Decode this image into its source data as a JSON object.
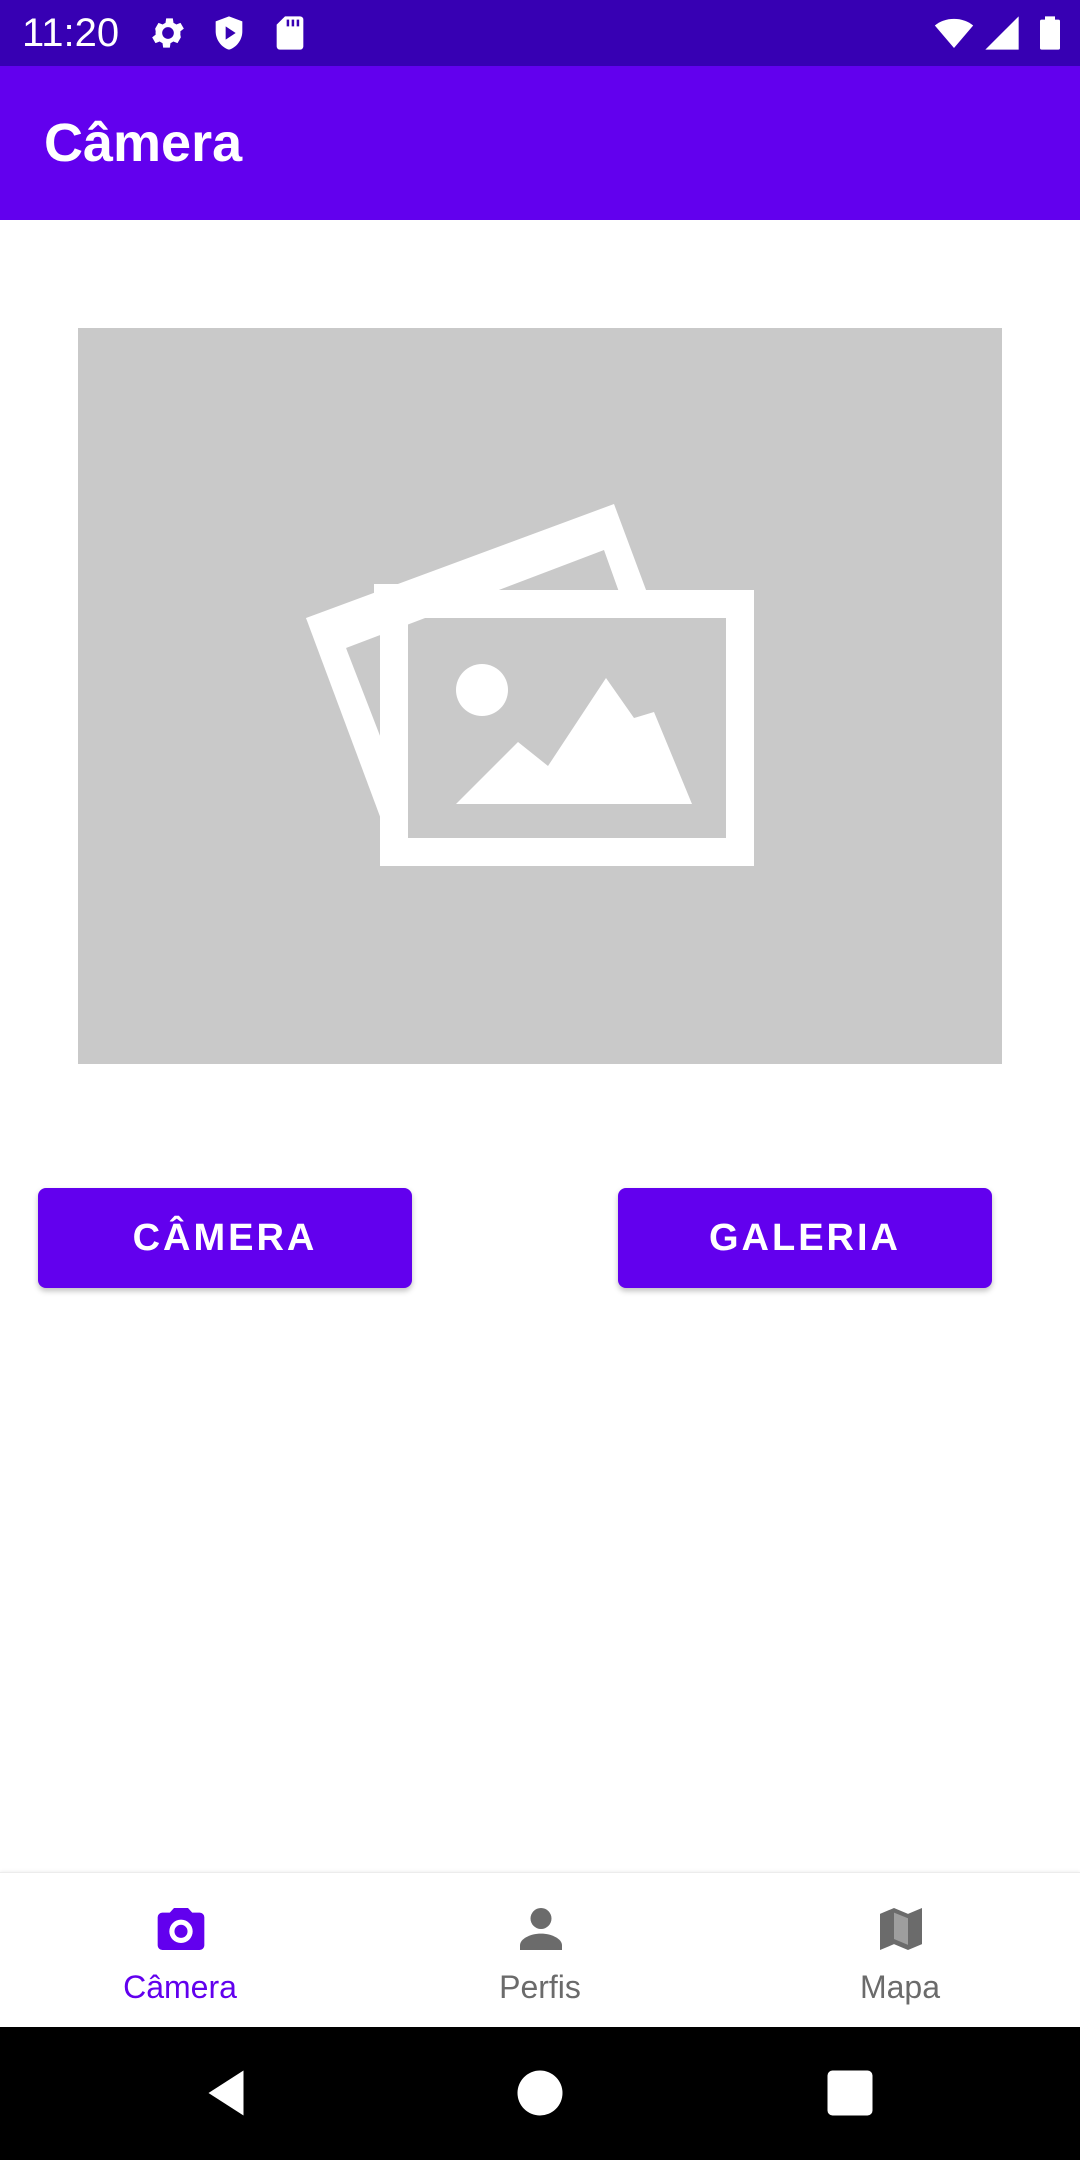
{
  "status_bar": {
    "time": "11:20",
    "left_icons": [
      "gear-icon",
      "shield-icon",
      "sd-card-icon"
    ],
    "right_icons": [
      "wifi-icon",
      "signal-icon",
      "battery-icon"
    ]
  },
  "app_bar": {
    "title": "Câmera"
  },
  "preview": {
    "icon": "image-placeholder-icon"
  },
  "buttons": {
    "camera_label": "CÂMERA",
    "gallery_label": "GALERIA"
  },
  "bottom_nav": {
    "items": [
      {
        "label": "Câmera",
        "icon": "camera-icon",
        "active": true
      },
      {
        "label": "Perfis",
        "icon": "person-icon",
        "active": false
      },
      {
        "label": "Mapa",
        "icon": "map-icon",
        "active": false
      }
    ]
  },
  "colors": {
    "primary": "#6200ee",
    "primary_dark": "#3700b3",
    "inactive": "#6b6b6b",
    "placeholder_bg": "#c9c9c9"
  }
}
